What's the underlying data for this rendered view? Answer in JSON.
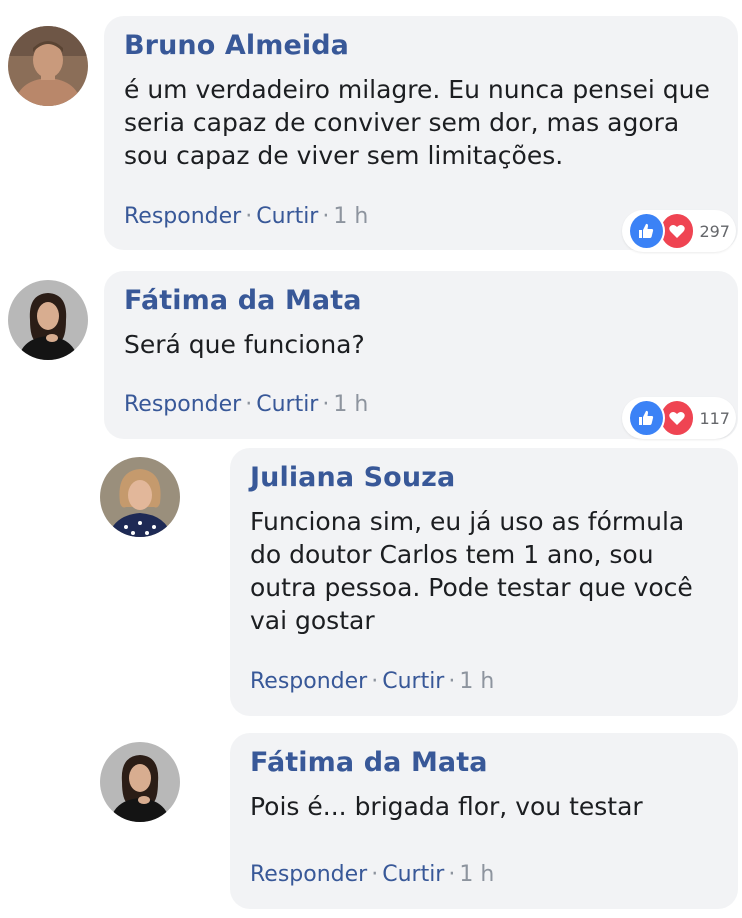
{
  "comments": [
    {
      "name": "Bruno Almeida",
      "text": "é um verdadeiro milagre. Eu nunca pensei que seria capaz de conviver sem dor, mas agora sou capaz de viver sem limitações.",
      "reply_label": "Responder",
      "like_label": "Curtir",
      "time": "1 h",
      "reaction_count": "297"
    },
    {
      "name": "Fátima da Mata",
      "text": "Será que funciona?",
      "reply_label": "Responder",
      "like_label": "Curtir",
      "time": "1 h",
      "reaction_count": "117"
    },
    {
      "name": "Juliana Souza",
      "text": "Funciona sim, eu já uso as fórmula do doutor Carlos tem 1 ano, sou outra pessoa. Pode testar que você vai gostar",
      "reply_label": "Responder",
      "like_label": "Curtir",
      "time": "1 h"
    },
    {
      "name": "Fátima da Mata",
      "text": "Pois é... brigada flor, vou testar",
      "reply_label": "Responder",
      "like_label": "Curtir",
      "time": "1 h"
    }
  ],
  "separator": "·",
  "colors": {
    "name": "#385898",
    "bubble": "#f2f3f5",
    "like": "#3b82f6",
    "love": "#ef4452"
  }
}
